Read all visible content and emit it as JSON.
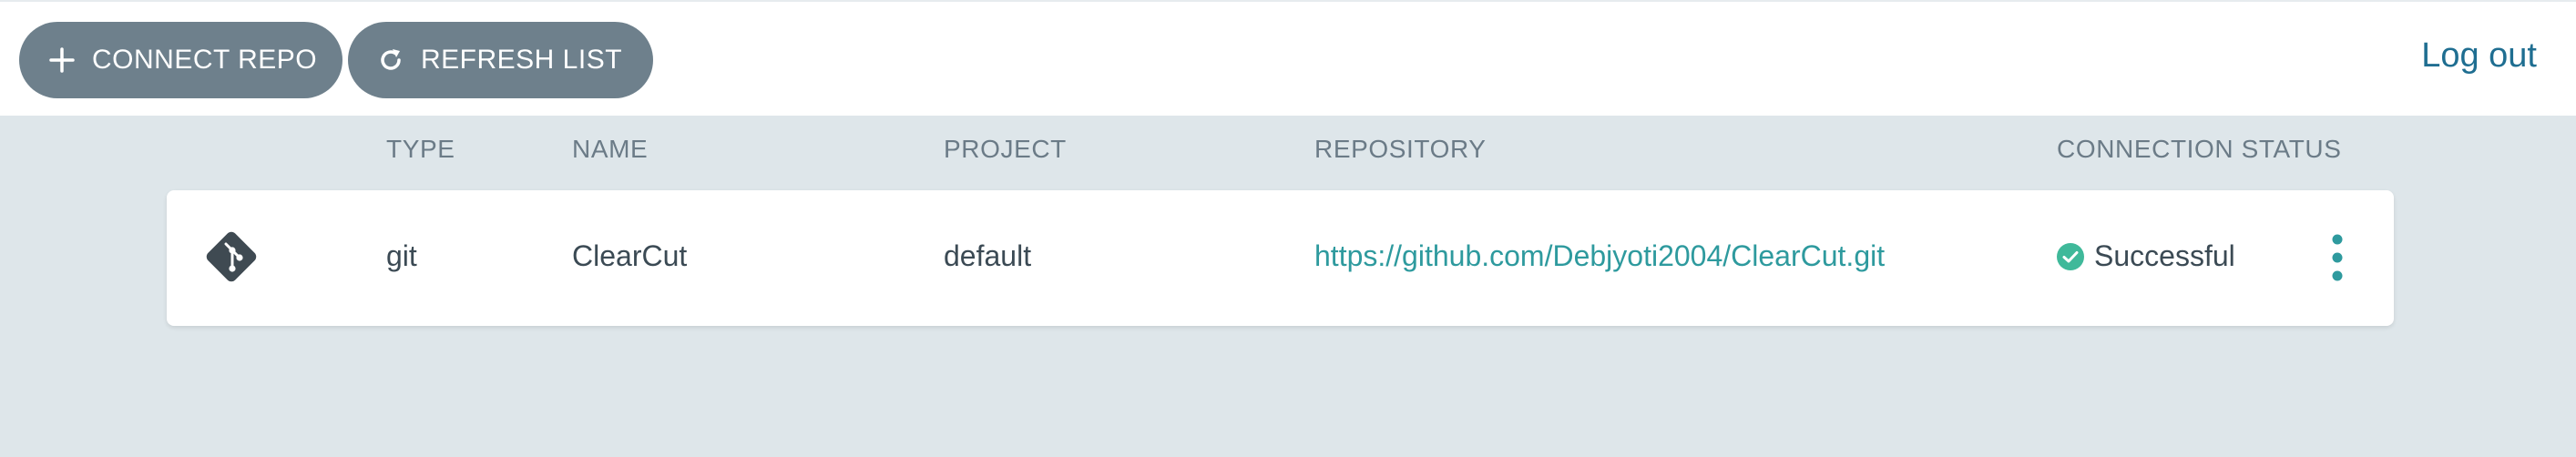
{
  "toolbar": {
    "connect_label": "CONNECT REPO",
    "refresh_label": "REFRESH LIST",
    "logout_label": "Log out"
  },
  "table": {
    "columns": [
      "TYPE",
      "NAME",
      "PROJECT",
      "REPOSITORY",
      "CONNECTION STATUS"
    ],
    "rows": [
      {
        "type_icon": "git-icon",
        "type": "git",
        "name": "ClearCut",
        "project": "default",
        "repository": "https://github.com/Debjyoti2004/ClearCut.git",
        "status": "Successful",
        "status_icon": "check-circle-icon"
      }
    ]
  },
  "colors": {
    "button_bg": "#6e808c",
    "link": "#2e9a9e",
    "success": "#3fb99a",
    "logout": "#1f6e91",
    "background": "#dee6ea"
  }
}
